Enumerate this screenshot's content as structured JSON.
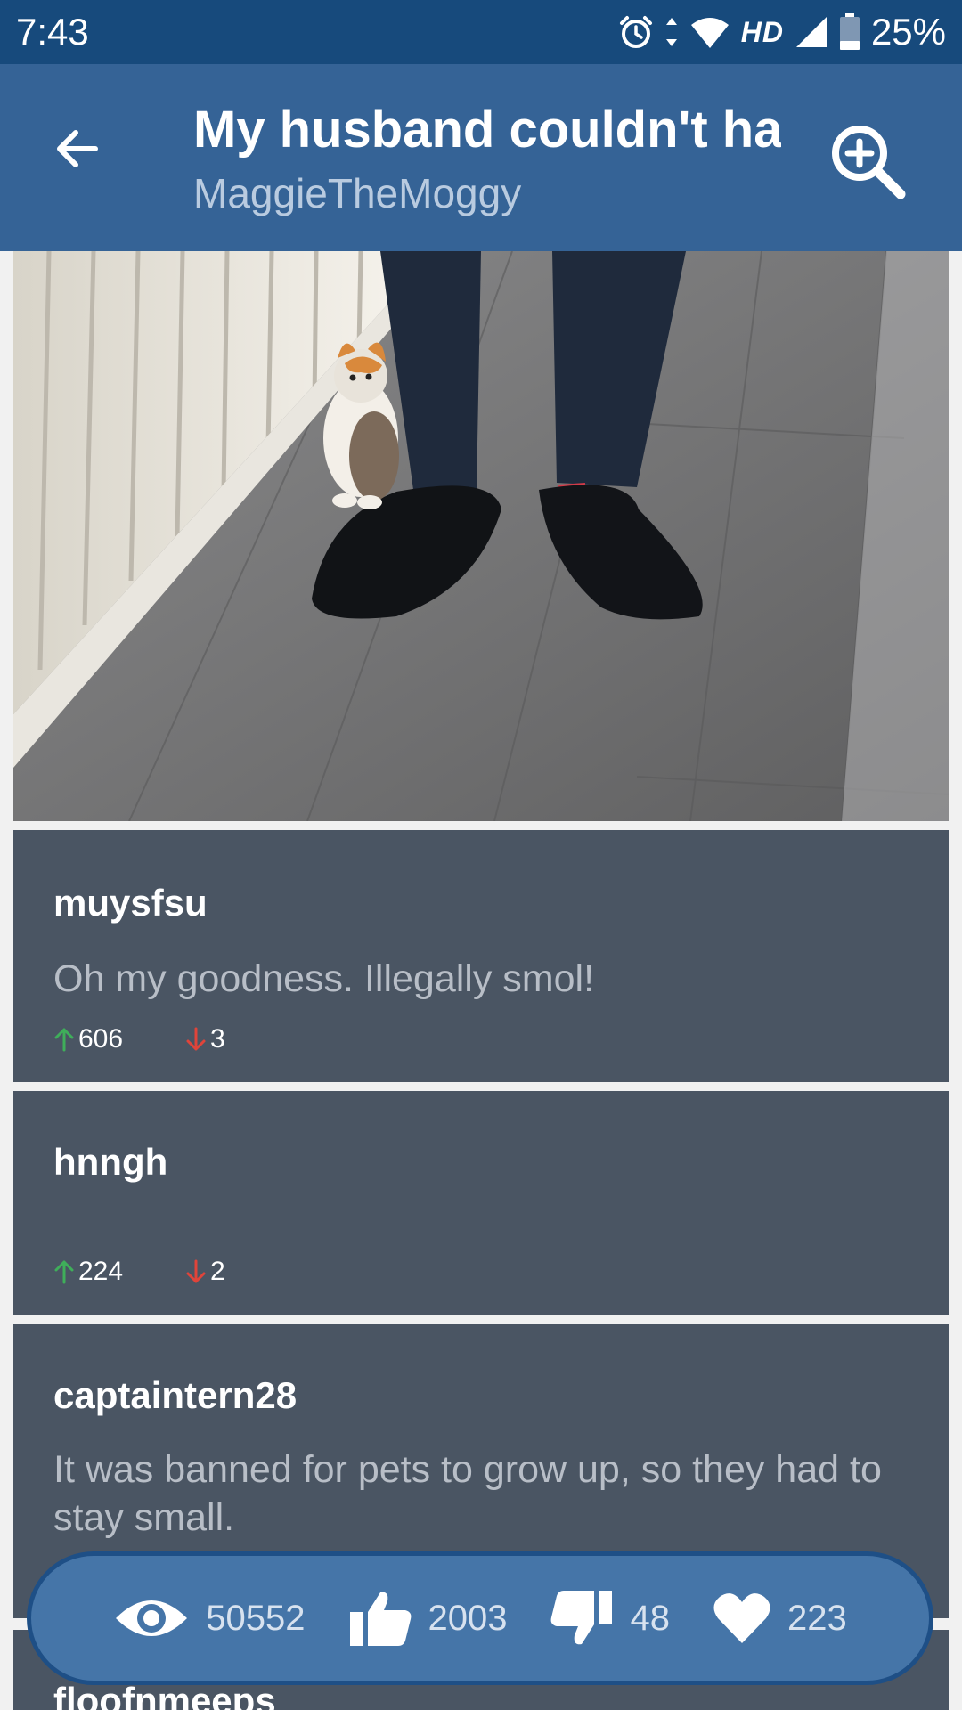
{
  "status_bar": {
    "time": "7:43",
    "network_label": "HD",
    "battery_percent": "25%",
    "icons": [
      "alarm-icon",
      "data-arrows-icon",
      "wifi-icon",
      "cell-signal-icon",
      "battery-icon"
    ]
  },
  "header": {
    "title": "My husband couldn't ha..",
    "subtitle": "MaggieTheMoggy",
    "back_icon": "arrow-left-icon",
    "zoom_icon": "zoom-in-icon"
  },
  "post_image": {
    "alt_icon": "photo"
  },
  "comments": [
    {
      "user": "muysfsu",
      "body": "Oh my goodness. Illegally smol!",
      "upvotes": "606",
      "downvotes": "3"
    },
    {
      "user": "hnngh",
      "body": "",
      "upvotes": "224",
      "downvotes": "2"
    },
    {
      "user": "captaintern28",
      "body": "It was banned for pets to grow up, so they had to stay small.",
      "upvotes": "",
      "downvotes": ""
    },
    {
      "user": "floofnmeeps",
      "body": "",
      "upvotes": "",
      "downvotes": ""
    }
  ],
  "stats": {
    "views": "50552",
    "likes": "2003",
    "dislikes": "48",
    "favorites": "223"
  },
  "colors": {
    "status_bar": "#174a7c",
    "app_bar": "#356396",
    "comment_bg": "#4a5563",
    "upvote": "#3fae5a",
    "downvote": "#e0443a",
    "stats_bar": "#4575a8"
  }
}
